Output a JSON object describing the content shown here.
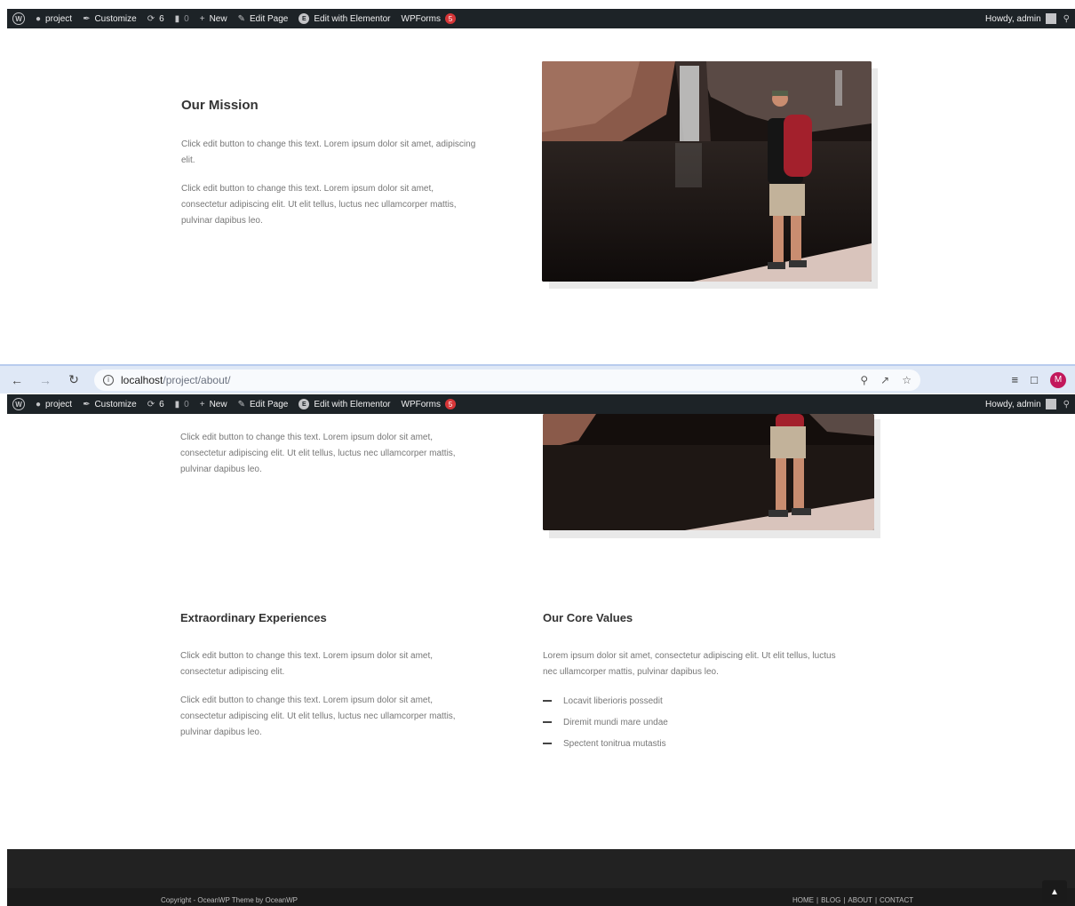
{
  "admin_bar": {
    "site_name": "project",
    "customize": "Customize",
    "updates_count": "6",
    "comments_count": "0",
    "new_label": "New",
    "edit_page": "Edit Page",
    "edit_elementor": "Edit with Elementor",
    "wpforms": "WPForms",
    "wpforms_badge": "5",
    "howdy": "Howdy, admin"
  },
  "browser": {
    "url_host": "localhost",
    "url_path": "/project/about/",
    "profile_initial": "M"
  },
  "mission": {
    "heading": "Our Mission",
    "para1": "Click edit button to change this text. Lorem ipsum dolor sit amet, adipiscing elit.",
    "para2": "Click edit button to change this text. Lorem ipsum dolor sit amet, consectetur adipiscing elit. Ut elit tellus, luctus nec ullamcorper mattis, pulvinar dapibus leo."
  },
  "scrolled": {
    "para2": "Click edit button to change this text. Lorem ipsum dolor sit amet, consectetur adipiscing elit. Ut elit tellus, luctus nec ullamcorper mattis, pulvinar dapibus leo."
  },
  "experiences": {
    "heading": "Extraordinary Experiences",
    "para1": "Click edit button to change this text. Lorem ipsum dolor sit amet, consectetur adipiscing elit.",
    "para2": "Click edit button to change this text. Lorem ipsum dolor sit amet, consectetur adipiscing elit. Ut elit tellus, luctus nec ullamcorper mattis, pulvinar dapibus leo."
  },
  "core_values": {
    "heading": "Our Core Values",
    "para": "Lorem ipsum dolor sit amet, consectetur adipiscing elit. Ut elit tellus, luctus nec ullamcorper mattis, pulvinar dapibus leo.",
    "items": [
      "Locavit liberioris possedit",
      "Diremit mundi mare undae",
      "Spectent tonitrua mutastis"
    ]
  },
  "footer": {
    "copyright": "Copyright - OceanWP Theme by OceanWP",
    "nav": [
      "HOME",
      "BLOG",
      "ABOUT",
      "CONTACT"
    ],
    "separator": "|"
  }
}
